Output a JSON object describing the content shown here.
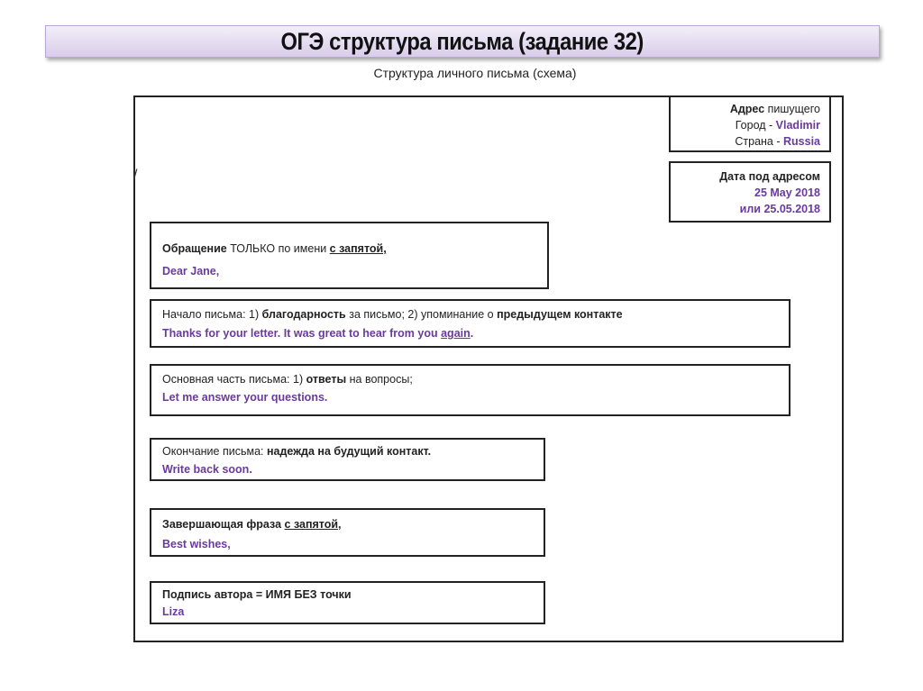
{
  "title": "ОГЭ структура письма (задание 32)",
  "subtitle": "Структура личного письма (схема)",
  "colors": {
    "accent": "#6a3a9c"
  },
  "boxes": [
    {
      "id": "address",
      "lines": [
        [
          {
            "t": "Адрес",
            "b": true
          },
          {
            "t": " пишущего"
          }
        ],
        [
          {
            "t": "Город - "
          },
          {
            "t": "Vladimir",
            "p": true
          }
        ],
        [
          {
            "t": "Страна - "
          },
          {
            "t": "Russia",
            "p": true
          }
        ]
      ]
    },
    {
      "id": "date",
      "lines": [
        [
          {
            "t": "Дата под адресом",
            "b": true
          }
        ],
        [
          {
            "t": "25 May 2018",
            "p": true
          }
        ],
        [
          {
            "t": "или 25.05.2018",
            "p": true
          }
        ]
      ]
    },
    {
      "id": "greeting",
      "lines": [
        [
          {
            "t": "Обращение",
            "b": true
          },
          {
            "t": " ТОЛЬКО по имени "
          },
          {
            "t": "с запятой,",
            "b": true,
            "u": true
          }
        ],
        [
          {
            "t": "Dear Jane,",
            "p": true
          }
        ]
      ]
    },
    {
      "id": "opening",
      "lines": [
        [
          {
            "t": "Начало письма: 1) "
          },
          {
            "t": "благодарность",
            "b": true
          },
          {
            "t": " за письмо; 2) упоминание о "
          },
          {
            "t": "предыдущем контакте",
            "b": true
          }
        ],
        [
          {
            "t": "Thanks for your letter. It was great to hear from you ",
            "p": true
          },
          {
            "t": "again",
            "p": true,
            "u": true
          },
          {
            "t": ".",
            "p": true
          }
        ]
      ]
    },
    {
      "id": "main-part",
      "lines": [
        [
          {
            "t": "Основная часть письма: 1) "
          },
          {
            "t": "ответы",
            "b": true
          },
          {
            "t": " на вопросы;"
          }
        ],
        [
          {
            "t": "Let me answer your questions.",
            "p": true
          }
        ]
      ]
    },
    {
      "id": "ending",
      "lines": [
        [
          {
            "t": "Окончание письма: "
          },
          {
            "t": "надежда на будущий контакт.",
            "b": true
          }
        ],
        [
          {
            "t": "Write back soon.",
            "p": true
          }
        ]
      ]
    },
    {
      "id": "closing",
      "lines": [
        [
          {
            "t": "Завершающая фраза ",
            "b": true
          },
          {
            "t": "с запятой,",
            "b": true,
            "u": true
          }
        ],
        [
          {
            "t": "Best wishes",
            "p": true
          },
          {
            "t": ",",
            "p": true,
            "u": true
          }
        ]
      ]
    },
    {
      "id": "signature",
      "lines": [
        [
          {
            "t": "Подпись автора = ИМЯ БЕЗ точки",
            "b": true
          }
        ],
        [
          {
            "t": "Liza",
            "p": true
          }
        ]
      ]
    }
  ]
}
